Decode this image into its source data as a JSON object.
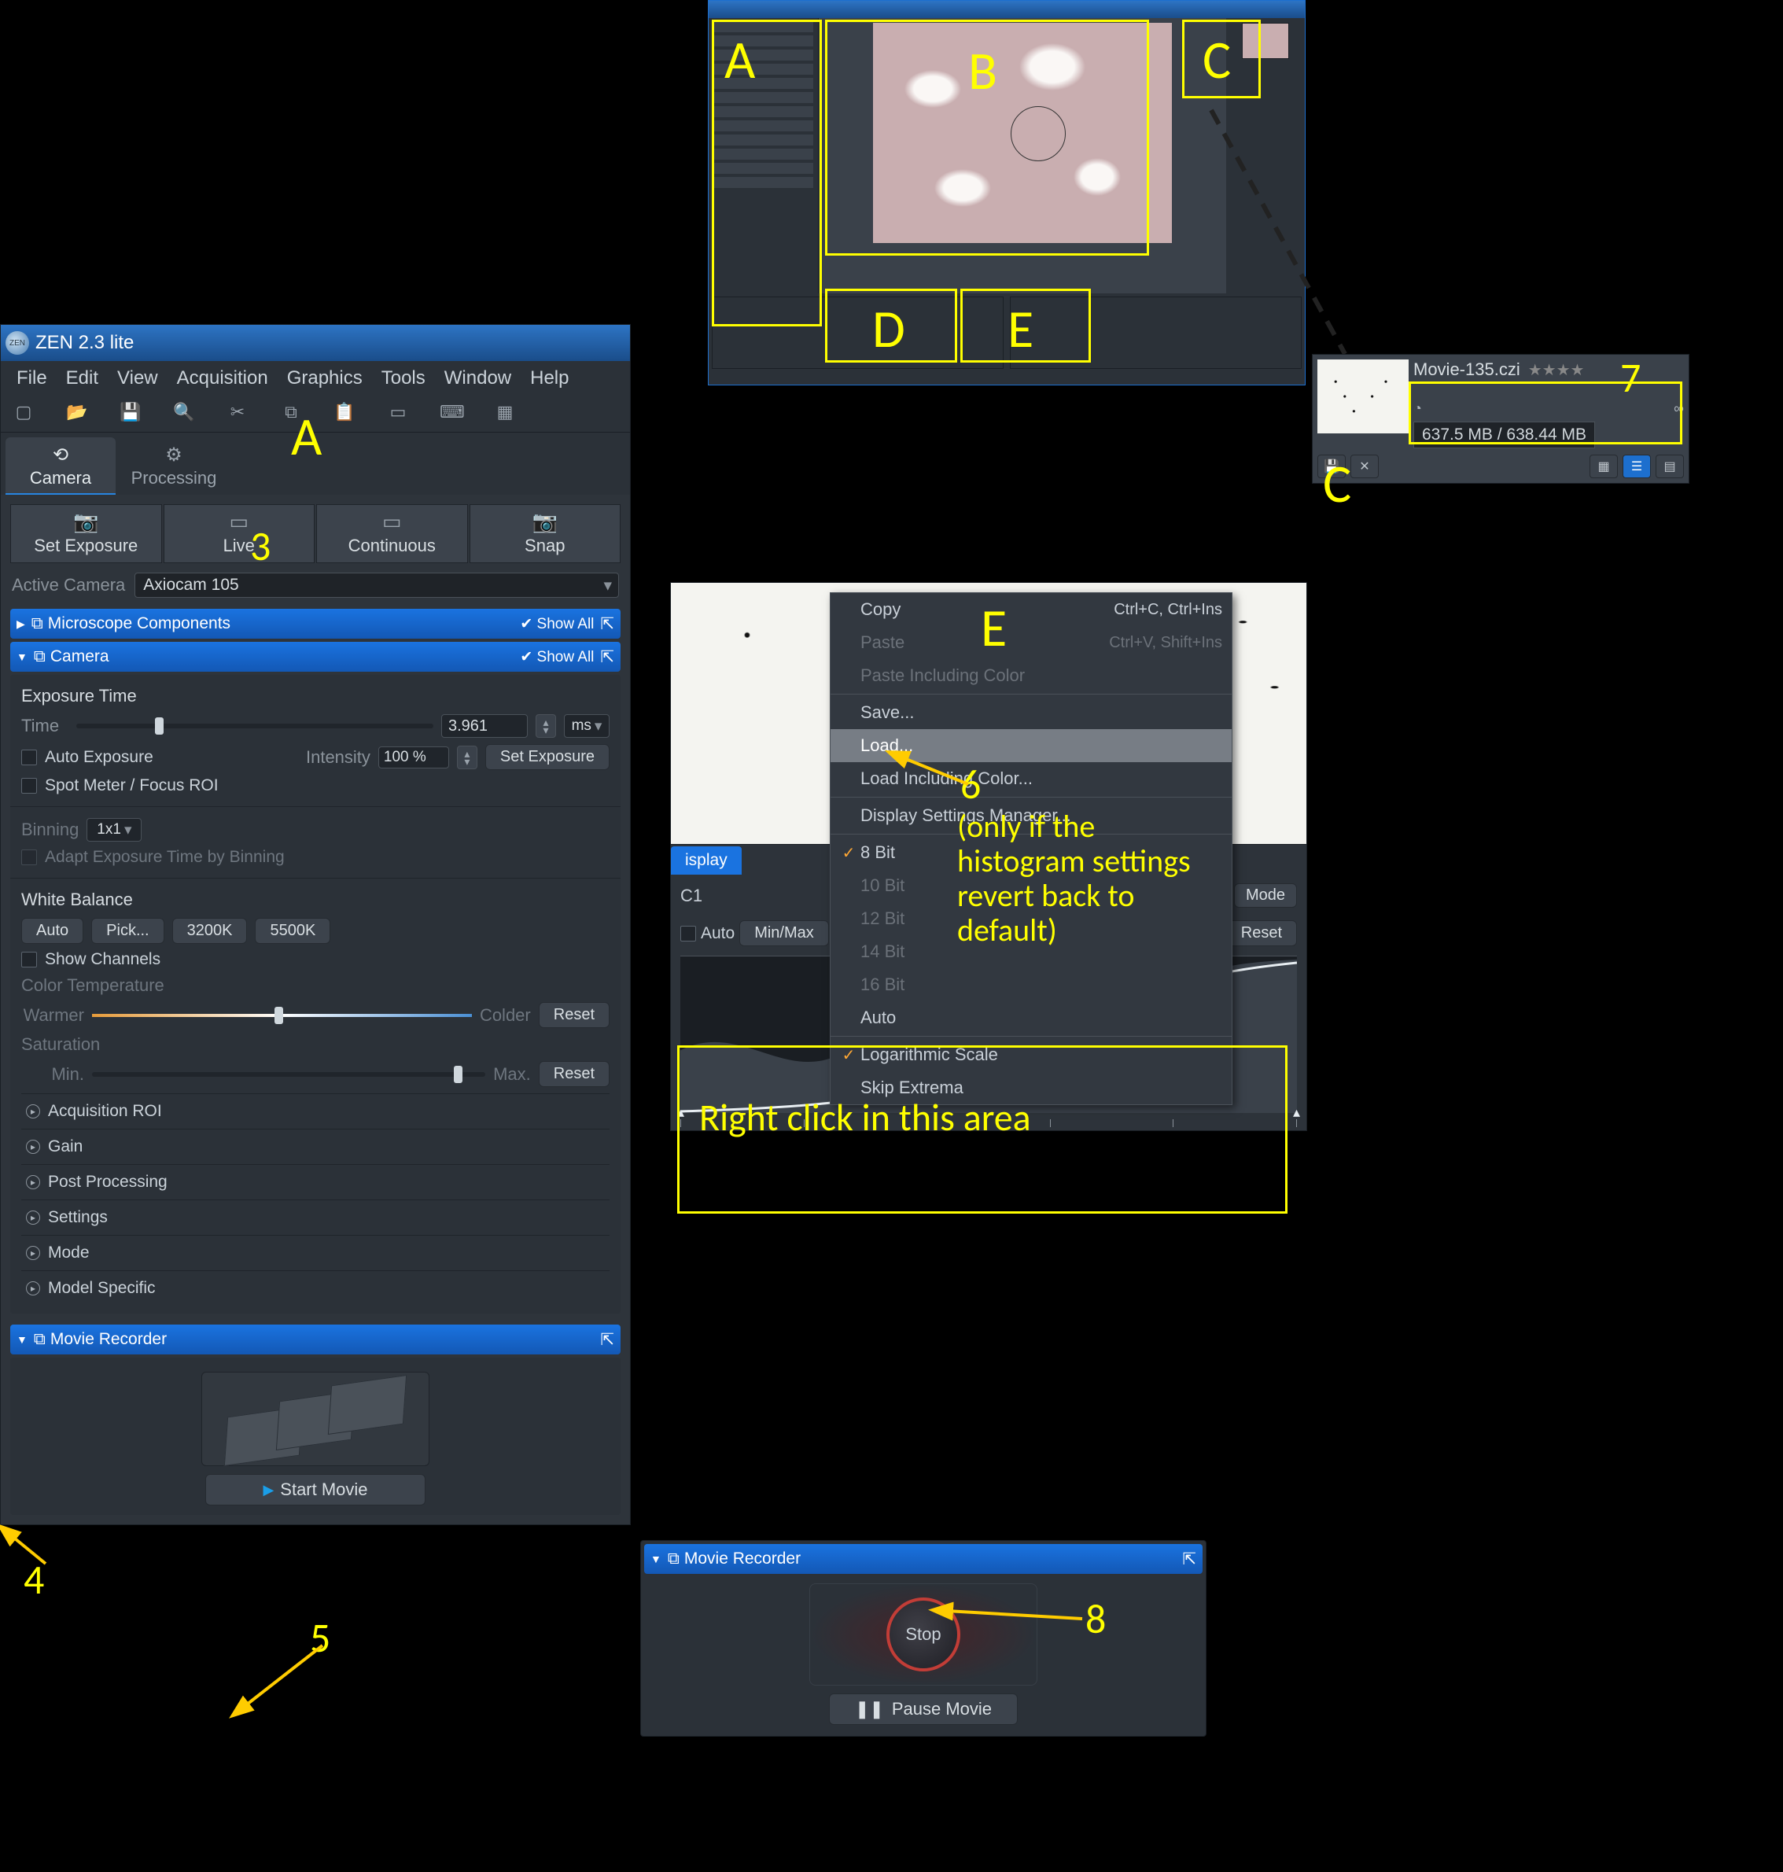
{
  "app": {
    "title": "ZEN 2.3 lite"
  },
  "menu": [
    "File",
    "Edit",
    "View",
    "Acquisition",
    "Graphics",
    "Tools",
    "Window",
    "Help"
  ],
  "tabs": {
    "camera": "Camera",
    "processing": "Processing"
  },
  "acq_buttons": {
    "set_exposure": "Set Exposure",
    "live": "Live",
    "continuous": "Continuous",
    "snap": "Snap"
  },
  "active_camera": {
    "label": "Active Camera",
    "value": "Axiocam 105"
  },
  "bluebars": {
    "microscope": "Microscope Components",
    "camera": "Camera",
    "show_all": "Show All",
    "movie_rec": "Movie Recorder"
  },
  "camera_panel": {
    "exposure_hdr": "Exposure Time",
    "time_lbl": "Time",
    "time_val": "3.961",
    "unit": "ms",
    "auto_exp": "Auto Exposure",
    "intensity_lbl": "Intensity",
    "intensity_val": "100 %",
    "set_exposure": "Set Exposure",
    "spot": "Spot Meter / Focus ROI",
    "binning_lbl": "Binning",
    "binning_val": "1x1",
    "adapt": "Adapt Exposure Time by Binning",
    "wb_hdr": "White Balance",
    "wb_auto": "Auto",
    "wb_pick": "Pick...",
    "wb_3200": "3200K",
    "wb_5500": "5500K",
    "show_ch": "Show Channels",
    "ctemp": "Color Temperature",
    "warmer": "Warmer",
    "colder": "Colder",
    "reset": "Reset",
    "sat": "Saturation",
    "min": "Min.",
    "max": "Max."
  },
  "collapsed": [
    "Acquisition ROI",
    "Gain",
    "Post Processing",
    "Settings",
    "Mode",
    "Model Specific"
  ],
  "movie": {
    "start": "Start Movie",
    "stop": "Stop",
    "pause": "Pause Movie"
  },
  "panelC": {
    "name": "Movie-135.czi",
    "size": "637.5 MB / 638.44 MB",
    "stars": "★★★★"
  },
  "contextmenu": {
    "copy": "Copy",
    "copy_hk": "Ctrl+C, Ctrl+Ins",
    "paste": "Paste",
    "paste_hk": "Ctrl+V, Shift+Ins",
    "paste_color": "Paste Including Color",
    "save": "Save...",
    "load": "Load...",
    "load_color": "Load Including Color...",
    "dsm": "Display Settings Manager...",
    "b8": "8 Bit",
    "b10": "10 Bit",
    "b12": "12 Bit",
    "b14": "14 Bit",
    "b16": "16 Bit",
    "auto": "Auto",
    "log": "Logarithmic Scale",
    "skip": "Skip Extrema"
  },
  "display": {
    "tab": "isplay",
    "c1": "C1",
    "mode": "Mode",
    "auto": "Auto",
    "minmax": "Min/Max",
    "reset": "Reset"
  },
  "annotations": {
    "A": "A",
    "B": "B",
    "C": "C",
    "D": "D",
    "E": "E",
    "C2": "C",
    "n3": "3",
    "n4": "4",
    "n5": "5",
    "n6": "6",
    "n7": "7",
    "n8": "8",
    "rc": "Right click in this area",
    "note": "(only if the\nhistogram settings\nrevert back to\ndefault)"
  }
}
